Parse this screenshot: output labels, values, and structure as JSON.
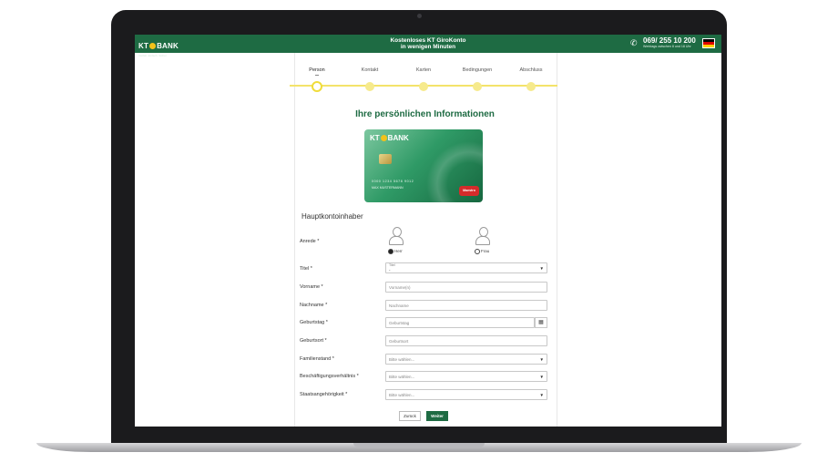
{
  "header": {
    "logo_text_left": "KT",
    "logo_text_right": "BANK",
    "logo_tagline": "Vielfalt. Einfach. Sicher.",
    "title_line1": "Kostenloses KT GiroKonto",
    "title_line2": "in wenigen Minuten",
    "phone_number": "069/ 255 10 200",
    "phone_hours": "Werktags zwischen 8 und 18 Uhr",
    "brand_color": "#1e6b43"
  },
  "steps": [
    {
      "label": "Person",
      "active": true
    },
    {
      "label": "Kontakt",
      "active": false
    },
    {
      "label": "Karten",
      "active": false
    },
    {
      "label": "Bedingungen",
      "active": false
    },
    {
      "label": "Abschluss",
      "active": false
    }
  ],
  "page_title": "Ihre persönlichen Informationen",
  "card": {
    "logo_left": "KT",
    "logo_right": "BANK",
    "number": "0000 1234 5678 9012",
    "holder": "MAX MUSTERMANN",
    "brand": "Maestro"
  },
  "section_title": "Hauptkontoinhaber",
  "anrede": {
    "label": "Anrede *",
    "options": [
      {
        "label": "Herr",
        "checked": true
      },
      {
        "label": "Frau",
        "checked": false
      }
    ]
  },
  "fields": {
    "titel": {
      "label": "Titel *",
      "top_label": "Titel",
      "value": "-"
    },
    "vorname": {
      "label": "Vorname *",
      "placeholder": "Vorname(n)"
    },
    "nachname": {
      "label": "Nachname *",
      "placeholder": "Nachname"
    },
    "geburtstag": {
      "label": "Geburtstag *",
      "placeholder": "Geburtstag"
    },
    "geburtsort": {
      "label": "Geburtsort *",
      "placeholder": "Geburtsort"
    },
    "familienstand": {
      "label": "Familienstand *",
      "value": "Bitte wählen..."
    },
    "beschaeftigung": {
      "label": "Beschäftigungsverhältnis *",
      "value": "Bitte wählen..."
    },
    "staatsangehoerigkeit": {
      "label": "Staatsangehörigkeit *",
      "value": "Bitte wählen..."
    }
  },
  "buttons": {
    "back": "Zurück",
    "next": "Weiter"
  },
  "icons": {
    "phone": "phone-icon",
    "calendar": "calendar-icon",
    "chevron": "chevron-down-icon",
    "flag": "german-flag-icon",
    "avatar": "user-avatar-icon"
  },
  "flag_colors": [
    "#000000",
    "#dd0000",
    "#ffce00"
  ]
}
